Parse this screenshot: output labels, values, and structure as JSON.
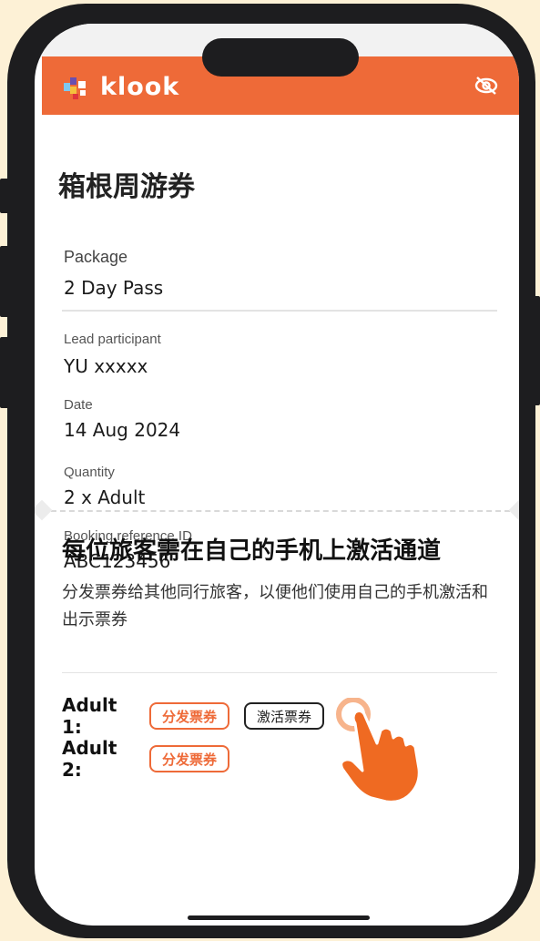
{
  "app": {
    "brand": "klook",
    "brand_color": "#ee6a38"
  },
  "header": {
    "hide_icon": "eye-slash-icon"
  },
  "page": {
    "title": "箱根周游券"
  },
  "booking": {
    "package_label": "Package",
    "package_value": "2 Day Pass",
    "lead_label": "Lead participant",
    "lead_value": "YU xxxxx",
    "date_label": "Date",
    "date_value": "14 Aug 2024",
    "quantity_label": "Quantity",
    "quantity_value": "2 x Adult",
    "ref_label": "Booking reference ID",
    "ref_value": "ABC123456"
  },
  "activation": {
    "heading": "每位旅客需在自己的手机上激活通道",
    "description": "分发票券给其他同行旅客，以便他们使用自己的手机激活和出示票券",
    "travellers": [
      {
        "label": "Adult 1:",
        "share": "分发票券",
        "activate": "激活票券"
      },
      {
        "label": "Adult 2:",
        "share": "分发票券"
      }
    ]
  },
  "overlay": {
    "pointer_icon": "pointing-hand-icon"
  }
}
